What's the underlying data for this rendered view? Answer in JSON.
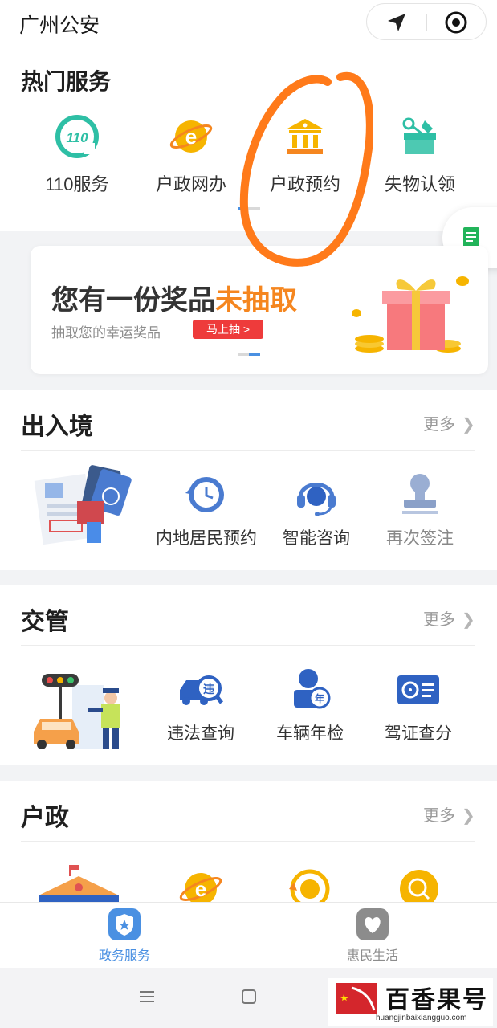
{
  "header": {
    "title": "广州公安",
    "nav_icon": "navigation-arrow-icon",
    "target_icon": "target-circle-icon"
  },
  "hot": {
    "title": "热门服务",
    "items": [
      {
        "label": "110服务",
        "icon": "110-icon"
      },
      {
        "label": "户政网办",
        "icon": "e-planet-icon"
      },
      {
        "label": "户政预约",
        "icon": "bank-building-icon"
      },
      {
        "label": "失物认领",
        "icon": "lost-found-box-icon"
      }
    ]
  },
  "banner": {
    "title_main": "您有一份奖品",
    "title_highlight": "未抽取",
    "subtitle": "抽取您的幸运奖品",
    "button": "马上抽 >"
  },
  "exit_entry": {
    "title": "出入境",
    "more": "更多",
    "items": [
      {
        "label": "内地居民预约",
        "icon": "clock-refresh-icon"
      },
      {
        "label": "智能咨询",
        "icon": "headset-icon"
      },
      {
        "label": "再次签注",
        "icon": "stamp-icon"
      }
    ]
  },
  "traffic": {
    "title": "交管",
    "more": "更多",
    "items": [
      {
        "label": "违法查询",
        "icon": "car-violation-search-icon"
      },
      {
        "label": "车辆年检",
        "icon": "annual-inspection-icon"
      },
      {
        "label": "驾证查分",
        "icon": "driver-license-icon"
      }
    ]
  },
  "household": {
    "title": "户政",
    "more": "更多"
  },
  "tabbar": {
    "items": [
      {
        "label": "政务服务",
        "icon": "shield-star-icon",
        "active": true
      },
      {
        "label": "惠民生活",
        "icon": "heart-icon",
        "active": false
      }
    ]
  },
  "watermark": {
    "text": "百香果号",
    "url": "huangjinbaixiangguo.com"
  },
  "colors": {
    "accent_blue": "#4a90e2",
    "highlight_orange": "#f5861f",
    "button_red": "#ee3b3b",
    "annotation_orange": "#ff7a1a",
    "teal": "#2ebfa5",
    "gold": "#f6b400"
  }
}
